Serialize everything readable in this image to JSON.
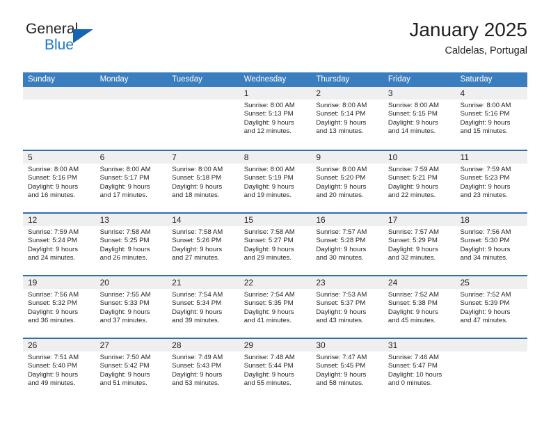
{
  "brand": {
    "name_top": "General",
    "name_bottom": "Blue",
    "triangle_color": "#1565b0",
    "blue_text_color": "#1878c8"
  },
  "header": {
    "title": "January 2025",
    "subtitle": "Caldelas, Portugal"
  },
  "theme": {
    "header_row_bg": "#3b7ec0",
    "week_separator": "#2f6ead",
    "daynum_band_bg": "#efefef",
    "text": "#231f20"
  },
  "weekdays": [
    "Sunday",
    "Monday",
    "Tuesday",
    "Wednesday",
    "Thursday",
    "Friday",
    "Saturday"
  ],
  "weeks": [
    [
      {
        "day": "",
        "empty": true
      },
      {
        "day": "",
        "empty": true
      },
      {
        "day": "",
        "empty": true
      },
      {
        "day": "1",
        "sunrise": "Sunrise: 8:00 AM",
        "sunset": "Sunset: 5:13 PM",
        "daylight1": "Daylight: 9 hours",
        "daylight2": "and 12 minutes."
      },
      {
        "day": "2",
        "sunrise": "Sunrise: 8:00 AM",
        "sunset": "Sunset: 5:14 PM",
        "daylight1": "Daylight: 9 hours",
        "daylight2": "and 13 minutes."
      },
      {
        "day": "3",
        "sunrise": "Sunrise: 8:00 AM",
        "sunset": "Sunset: 5:15 PM",
        "daylight1": "Daylight: 9 hours",
        "daylight2": "and 14 minutes."
      },
      {
        "day": "4",
        "sunrise": "Sunrise: 8:00 AM",
        "sunset": "Sunset: 5:16 PM",
        "daylight1": "Daylight: 9 hours",
        "daylight2": "and 15 minutes."
      }
    ],
    [
      {
        "day": "5",
        "sunrise": "Sunrise: 8:00 AM",
        "sunset": "Sunset: 5:16 PM",
        "daylight1": "Daylight: 9 hours",
        "daylight2": "and 16 minutes."
      },
      {
        "day": "6",
        "sunrise": "Sunrise: 8:00 AM",
        "sunset": "Sunset: 5:17 PM",
        "daylight1": "Daylight: 9 hours",
        "daylight2": "and 17 minutes."
      },
      {
        "day": "7",
        "sunrise": "Sunrise: 8:00 AM",
        "sunset": "Sunset: 5:18 PM",
        "daylight1": "Daylight: 9 hours",
        "daylight2": "and 18 minutes."
      },
      {
        "day": "8",
        "sunrise": "Sunrise: 8:00 AM",
        "sunset": "Sunset: 5:19 PM",
        "daylight1": "Daylight: 9 hours",
        "daylight2": "and 19 minutes."
      },
      {
        "day": "9",
        "sunrise": "Sunrise: 8:00 AM",
        "sunset": "Sunset: 5:20 PM",
        "daylight1": "Daylight: 9 hours",
        "daylight2": "and 20 minutes."
      },
      {
        "day": "10",
        "sunrise": "Sunrise: 7:59 AM",
        "sunset": "Sunset: 5:21 PM",
        "daylight1": "Daylight: 9 hours",
        "daylight2": "and 22 minutes."
      },
      {
        "day": "11",
        "sunrise": "Sunrise: 7:59 AM",
        "sunset": "Sunset: 5:23 PM",
        "daylight1": "Daylight: 9 hours",
        "daylight2": "and 23 minutes."
      }
    ],
    [
      {
        "day": "12",
        "sunrise": "Sunrise: 7:59 AM",
        "sunset": "Sunset: 5:24 PM",
        "daylight1": "Daylight: 9 hours",
        "daylight2": "and 24 minutes."
      },
      {
        "day": "13",
        "sunrise": "Sunrise: 7:58 AM",
        "sunset": "Sunset: 5:25 PM",
        "daylight1": "Daylight: 9 hours",
        "daylight2": "and 26 minutes."
      },
      {
        "day": "14",
        "sunrise": "Sunrise: 7:58 AM",
        "sunset": "Sunset: 5:26 PM",
        "daylight1": "Daylight: 9 hours",
        "daylight2": "and 27 minutes."
      },
      {
        "day": "15",
        "sunrise": "Sunrise: 7:58 AM",
        "sunset": "Sunset: 5:27 PM",
        "daylight1": "Daylight: 9 hours",
        "daylight2": "and 29 minutes."
      },
      {
        "day": "16",
        "sunrise": "Sunrise: 7:57 AM",
        "sunset": "Sunset: 5:28 PM",
        "daylight1": "Daylight: 9 hours",
        "daylight2": "and 30 minutes."
      },
      {
        "day": "17",
        "sunrise": "Sunrise: 7:57 AM",
        "sunset": "Sunset: 5:29 PM",
        "daylight1": "Daylight: 9 hours",
        "daylight2": "and 32 minutes."
      },
      {
        "day": "18",
        "sunrise": "Sunrise: 7:56 AM",
        "sunset": "Sunset: 5:30 PM",
        "daylight1": "Daylight: 9 hours",
        "daylight2": "and 34 minutes."
      }
    ],
    [
      {
        "day": "19",
        "sunrise": "Sunrise: 7:56 AM",
        "sunset": "Sunset: 5:32 PM",
        "daylight1": "Daylight: 9 hours",
        "daylight2": "and 36 minutes."
      },
      {
        "day": "20",
        "sunrise": "Sunrise: 7:55 AM",
        "sunset": "Sunset: 5:33 PM",
        "daylight1": "Daylight: 9 hours",
        "daylight2": "and 37 minutes."
      },
      {
        "day": "21",
        "sunrise": "Sunrise: 7:54 AM",
        "sunset": "Sunset: 5:34 PM",
        "daylight1": "Daylight: 9 hours",
        "daylight2": "and 39 minutes."
      },
      {
        "day": "22",
        "sunrise": "Sunrise: 7:54 AM",
        "sunset": "Sunset: 5:35 PM",
        "daylight1": "Daylight: 9 hours",
        "daylight2": "and 41 minutes."
      },
      {
        "day": "23",
        "sunrise": "Sunrise: 7:53 AM",
        "sunset": "Sunset: 5:37 PM",
        "daylight1": "Daylight: 9 hours",
        "daylight2": "and 43 minutes."
      },
      {
        "day": "24",
        "sunrise": "Sunrise: 7:52 AM",
        "sunset": "Sunset: 5:38 PM",
        "daylight1": "Daylight: 9 hours",
        "daylight2": "and 45 minutes."
      },
      {
        "day": "25",
        "sunrise": "Sunrise: 7:52 AM",
        "sunset": "Sunset: 5:39 PM",
        "daylight1": "Daylight: 9 hours",
        "daylight2": "and 47 minutes."
      }
    ],
    [
      {
        "day": "26",
        "sunrise": "Sunrise: 7:51 AM",
        "sunset": "Sunset: 5:40 PM",
        "daylight1": "Daylight: 9 hours",
        "daylight2": "and 49 minutes."
      },
      {
        "day": "27",
        "sunrise": "Sunrise: 7:50 AM",
        "sunset": "Sunset: 5:42 PM",
        "daylight1": "Daylight: 9 hours",
        "daylight2": "and 51 minutes."
      },
      {
        "day": "28",
        "sunrise": "Sunrise: 7:49 AM",
        "sunset": "Sunset: 5:43 PM",
        "daylight1": "Daylight: 9 hours",
        "daylight2": "and 53 minutes."
      },
      {
        "day": "29",
        "sunrise": "Sunrise: 7:48 AM",
        "sunset": "Sunset: 5:44 PM",
        "daylight1": "Daylight: 9 hours",
        "daylight2": "and 55 minutes."
      },
      {
        "day": "30",
        "sunrise": "Sunrise: 7:47 AM",
        "sunset": "Sunset: 5:45 PM",
        "daylight1": "Daylight: 9 hours",
        "daylight2": "and 58 minutes."
      },
      {
        "day": "31",
        "sunrise": "Sunrise: 7:46 AM",
        "sunset": "Sunset: 5:47 PM",
        "daylight1": "Daylight: 10 hours",
        "daylight2": "and 0 minutes."
      },
      {
        "day": "",
        "empty": true
      }
    ]
  ]
}
